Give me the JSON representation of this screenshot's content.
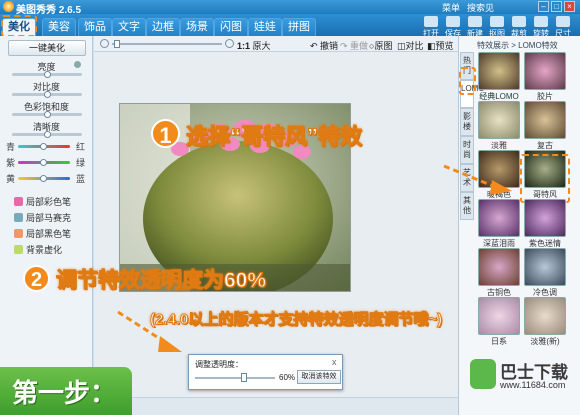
{
  "app": {
    "title": "美图秀秀 2.6.5",
    "links": [
      "菜单",
      "搜索见"
    ]
  },
  "tabs": [
    {
      "label": "美化",
      "active": true
    },
    {
      "label": "美容"
    },
    {
      "label": "饰品"
    },
    {
      "label": "文字"
    },
    {
      "label": "边框"
    },
    {
      "label": "场景"
    },
    {
      "label": "闪图"
    },
    {
      "label": "娃娃"
    },
    {
      "label": "拼图"
    }
  ],
  "toolbar_tools": [
    "打开",
    "保存",
    "新建",
    "抠图",
    "裁剪",
    "旋转",
    "尺寸"
  ],
  "left_panel": {
    "one_click": "一键美化",
    "sliders": [
      "亮度",
      "对比度",
      "色彩饱和度",
      "清晰度"
    ],
    "color_rows": [
      {
        "left": "青",
        "right": "红"
      },
      {
        "left": "紫",
        "right": "绿"
      },
      {
        "left": "黄",
        "right": "蓝"
      }
    ],
    "tools": [
      "局部彩色笔",
      "局部马赛克",
      "局部黑色笔",
      "背景虚化"
    ]
  },
  "canvas_bar": {
    "ratio": "1:1",
    "size_label": "原大",
    "undo": "撤销",
    "redo": "重做",
    "original": "原图",
    "compare": "对比",
    "preview": "预览"
  },
  "right_panel": {
    "header": "特效展示 > LOMO特效",
    "vtabs": [
      "热门",
      "LOMO",
      "影楼",
      "时尚",
      "艺术",
      "其他"
    ],
    "effects": [
      {
        "label": "经典LOMO"
      },
      {
        "label": "胶片"
      },
      {
        "label": "淡雅"
      },
      {
        "label": "复古"
      },
      {
        "label": "暖褐色"
      },
      {
        "label": "哥特风"
      },
      {
        "label": "深蓝泪雨"
      },
      {
        "label": "紫色迷情"
      },
      {
        "label": "古铜色"
      },
      {
        "label": "冷色调"
      },
      {
        "label": "日系"
      },
      {
        "label": "淡雅(新)"
      }
    ]
  },
  "dialog": {
    "label": "调整透明度：",
    "value": "60%",
    "cancel": "取消该特效",
    "close": "x"
  },
  "annotations": {
    "step1_num": "1",
    "step1_text": "选择“哥特风”特效",
    "step2_num": "2",
    "step2_text": "调节特效透明度为60%",
    "note": "(2.4.0以上的版本才支持特效透明度调节哦~)",
    "step_banner": "第一步："
  },
  "watermark": {
    "brand": "巴士下载",
    "url": "www.11684.com"
  },
  "colors": {
    "accent": "#f28a1c",
    "titlebar": "#1f7cc0",
    "banner": "#4fae38"
  }
}
